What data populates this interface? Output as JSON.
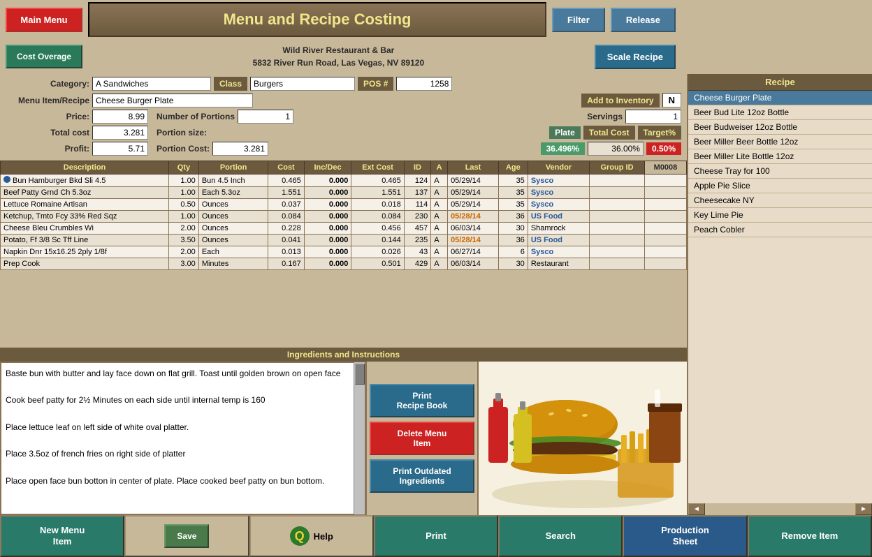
{
  "header": {
    "main_menu_label": "Main Menu",
    "title": "Menu  and  Recipe  Costing",
    "filter_label": "Filter",
    "release_label": "Release",
    "cost_overage_label": "Cost Overage",
    "restaurant_name": "Wild River Restaurant & Bar",
    "restaurant_address": "5832 River Run Road, Las Vegas, NV 89120",
    "scale_recipe_label": "Scale Recipe"
  },
  "form": {
    "category_label": "Category:",
    "category_value": "A Sandwiches",
    "class_label": "Class",
    "class_value": "Burgers",
    "pos_label": "POS #",
    "pos_value": "1258",
    "menu_item_label": "Menu Item/Recipe",
    "menu_item_value": "Cheese Burger Plate",
    "add_inventory_label": "Add to Inventory",
    "add_inventory_value": "N",
    "price_label": "Price:",
    "price_value": "8.99",
    "portions_label": "Number of Portions",
    "portions_value": "1",
    "servings_label": "Servings",
    "servings_value": "1",
    "total_cost_label": "Total cost",
    "total_cost_value": "3.281",
    "portion_size_label": "Portion size:",
    "portion_size_value": "Plate",
    "total_cost2_label": "Total Cost",
    "target_label": "Target%",
    "profit_label": "Profit:",
    "profit_value": "5.71",
    "portion_cost_label": "Portion Cost:",
    "portion_cost_value": "3.281",
    "pct_value": "36.496%",
    "target_value": "36.00%",
    "overage_value": "0.50%",
    "record_id": "M0008"
  },
  "table": {
    "headers": [
      "Description",
      "Qty",
      "Portion",
      "Cost",
      "Inc/Dec",
      "Ext Cost",
      "ID",
      "A",
      "Last",
      "Age",
      "Vendor",
      "Group ID"
    ],
    "rows": [
      {
        "desc": "Bun Hamburger Bkd Sli 4.5",
        "qty": "1.00",
        "portion": "Bun 4.5 Inch",
        "cost": "0.465",
        "inc_dec": "0.000",
        "ext_cost": "0.465",
        "id": "124",
        "a": "A",
        "last": "05/29/14",
        "age": "35",
        "vendor": "Sysco",
        "group_id": "",
        "highlight": false,
        "marker": true,
        "date_orange": false
      },
      {
        "desc": "Beef Patty Grnd Ch 5.3oz",
        "qty": "1.00",
        "portion": "Each 5.3oz",
        "cost": "1.551",
        "inc_dec": "0.000",
        "ext_cost": "1.551",
        "id": "137",
        "a": "A",
        "last": "05/29/14",
        "age": "35",
        "vendor": "Sysco",
        "group_id": "",
        "highlight": false,
        "marker": false,
        "date_orange": false
      },
      {
        "desc": "Lettuce Romaine Artisan",
        "qty": "0.50",
        "portion": "Ounces",
        "cost": "0.037",
        "inc_dec": "0.000",
        "ext_cost": "0.018",
        "id": "114",
        "a": "A",
        "last": "05/29/14",
        "age": "35",
        "vendor": "Sysco",
        "group_id": "",
        "highlight": false,
        "marker": false,
        "date_orange": false
      },
      {
        "desc": "Ketchup, Tmto Fcy 33% Red Sqz",
        "qty": "1.00",
        "portion": "Ounces",
        "cost": "0.084",
        "inc_dec": "0.000",
        "ext_cost": "0.084",
        "id": "230",
        "a": "A",
        "last": "05/28/14",
        "age": "36",
        "vendor": "US Food",
        "group_id": "",
        "highlight": false,
        "marker": false,
        "date_orange": true
      },
      {
        "desc": "Cheese Bleu Crumbles Wi",
        "qty": "2.00",
        "portion": "Ounces",
        "cost": "0.228",
        "inc_dec": "0.000",
        "ext_cost": "0.456",
        "id": "457",
        "a": "A",
        "last": "06/03/14",
        "age": "30",
        "vendor": "Shamrock",
        "group_id": "",
        "highlight": false,
        "marker": false,
        "date_orange": false
      },
      {
        "desc": "Potato, Ff 3/8 Sc Tff Line",
        "qty": "3.50",
        "portion": "Ounces",
        "cost": "0.041",
        "inc_dec": "0.000",
        "ext_cost": "0.144",
        "id": "235",
        "a": "A",
        "last": "05/28/14",
        "age": "36",
        "vendor": "US Food",
        "group_id": "",
        "highlight": false,
        "marker": false,
        "date_orange": true
      },
      {
        "desc": "Napkin Dnr 15x16.25 2ply 1/8f",
        "qty": "2.00",
        "portion": "Each",
        "cost": "0.013",
        "inc_dec": "0.000",
        "ext_cost": "0.026",
        "id": "43",
        "a": "A",
        "last": "06/27/14",
        "age": "6",
        "vendor": "Sysco",
        "group_id": "",
        "highlight": false,
        "marker": false,
        "date_orange": false
      },
      {
        "desc": "Prep Cook",
        "qty": "3.00",
        "portion": "Minutes",
        "cost": "0.167",
        "inc_dec": "0.000",
        "ext_cost": "0.501",
        "id": "429",
        "a": "A",
        "last": "06/03/14",
        "age": "30",
        "vendor": "Restaurant",
        "group_id": "",
        "highlight": false,
        "marker": false,
        "date_orange": false
      }
    ]
  },
  "instructions": {
    "header": "Ingredients and Instructions",
    "text": [
      "Baste bun with butter and lay face down on flat grill.  Toast until golden brown on open face",
      "",
      "Cook beef patty for 2½ Minutes on each side until internal temp is 160",
      "",
      "Place lettuce leaf on left side of white oval platter.",
      "",
      "Place 3.5oz of french fries on right side of platter",
      "",
      "Place open face bun botton in center of plate.  Place cooked beef patty on bun bottom."
    ]
  },
  "recipe_list": {
    "header": "Recipe",
    "items": [
      "Cheese Burger Plate",
      "Beer Bud Lite 12oz Bottle",
      "Beer Budweiser 12oz Bottle",
      "Beer Miller Beer Bottle 12oz",
      "Beer Miller Lite Bottle 12oz",
      "Cheese  Tray for 100",
      "Apple Pie Slice",
      "Cheesecake NY",
      "Key Lime Pie",
      "Peach Cobler"
    ],
    "selected_index": 0
  },
  "right_buttons": {
    "print_recipe_label": "Print\nRecipe Book",
    "delete_menu_label": "Delete  Menu\nItem",
    "print_outdated_label": "Print Outdated\nIngredients"
  },
  "bottom_bar": {
    "new_menu_item": "New Menu\nItem",
    "save": "Save",
    "help": "Help",
    "print": "Print",
    "search": "Search",
    "production_sheet": "Production\nSheet",
    "remove_item": "Remove Item"
  }
}
